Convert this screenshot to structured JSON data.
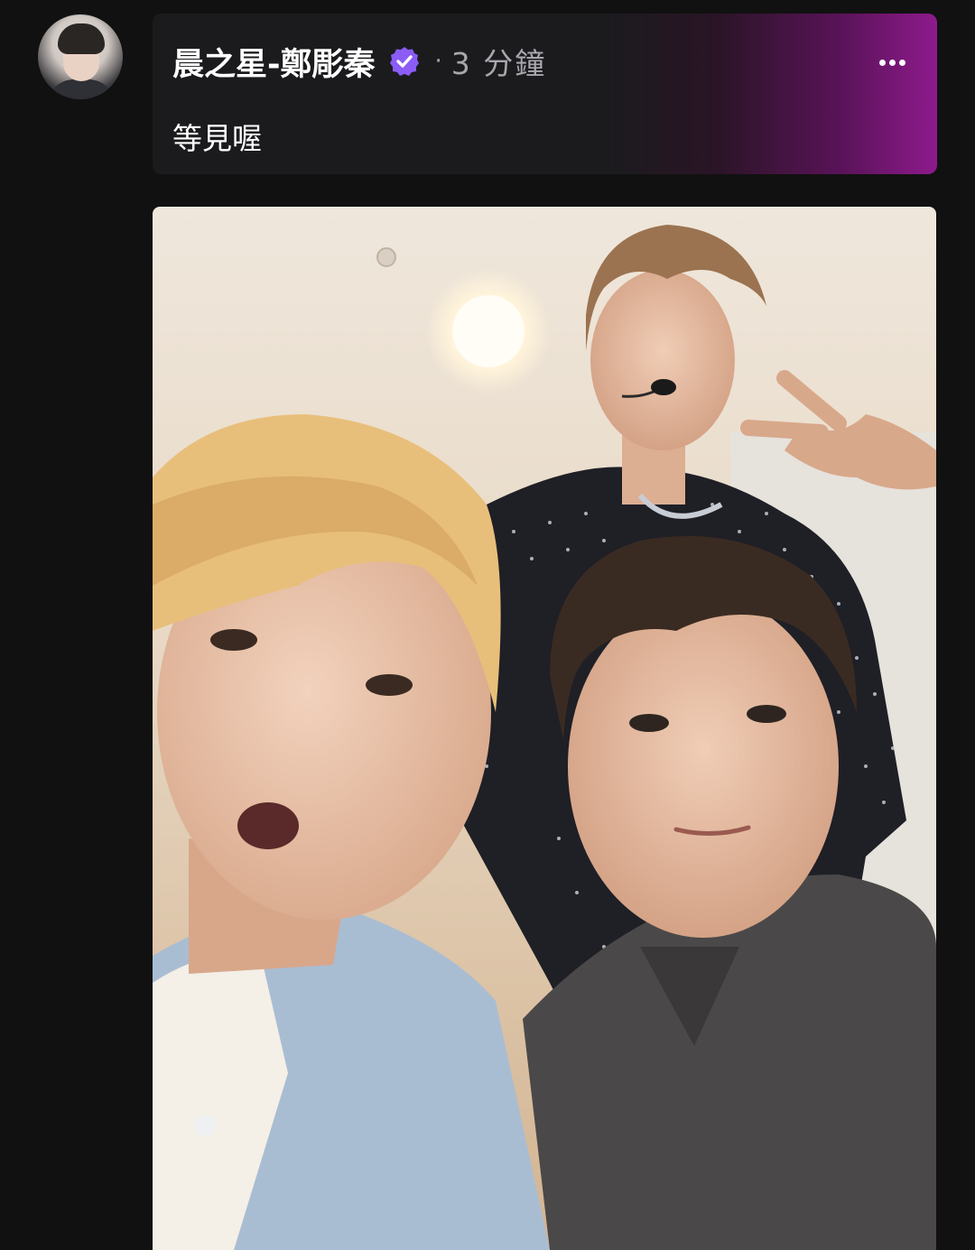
{
  "post": {
    "author_name": "晨之星-鄭彫秦",
    "separator": "·",
    "timestamp": "3 分鐘",
    "text": "等見喔",
    "verified": true
  },
  "icons": {
    "verified": "verified-badge-icon",
    "more": "more-options-icon"
  },
  "colors": {
    "background": "#111111",
    "card": "#1b1b1e",
    "accent_gradient_end": "#8e1a8c",
    "verified_badge": "#8b5cf6",
    "muted_text": "#a7a7ad"
  }
}
